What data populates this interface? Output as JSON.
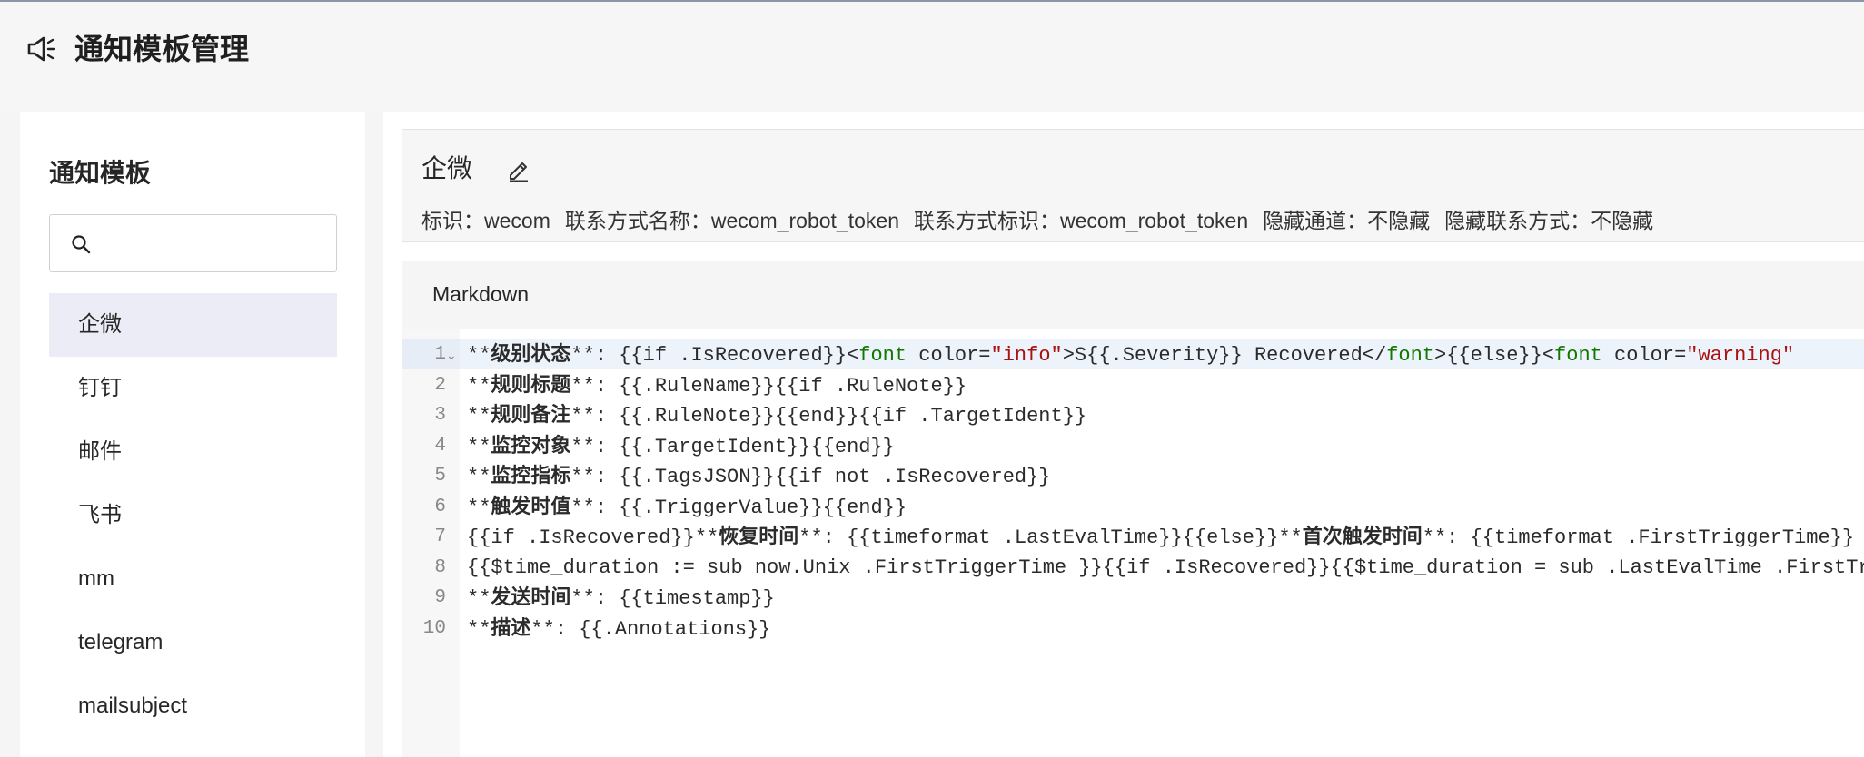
{
  "header": {
    "title": "通知模板管理",
    "icon": "megaphone-icon"
  },
  "sidebar": {
    "title": "通知模板",
    "search": {
      "placeholder": "",
      "value": ""
    },
    "items": [
      {
        "label": "企微",
        "active": true
      },
      {
        "label": "钉钉"
      },
      {
        "label": "邮件"
      },
      {
        "label": "飞书"
      },
      {
        "label": "mm"
      },
      {
        "label": "telegram"
      },
      {
        "label": "mailsubject"
      }
    ]
  },
  "detail": {
    "name": "企微",
    "ident_label": "标识：",
    "ident": "wecom",
    "contact_name_label": "联系方式名称：",
    "contact_name": "wecom_robot_token",
    "contact_ident_label": "联系方式标识：",
    "contact_ident": "wecom_robot_token",
    "hide_channel_label": "隐藏通道：",
    "hide_channel": "不隐藏",
    "hide_contact_label": "隐藏联系方式：",
    "hide_contact": "不隐藏"
  },
  "editor": {
    "tab": "Markdown",
    "line_numbers": [
      "1",
      "2",
      "3",
      "4",
      "5",
      "6",
      "7",
      "8",
      "9",
      "10"
    ],
    "lines": [
      {
        "a": "**",
        "b": "级别状态",
        "c": "**: {{if .IsRecovered}}<",
        "d": "font",
        "e": " color=",
        "f": "\"info\"",
        "g": ">S{{.Severity}} Recovered</",
        "h": "font",
        "i": ">{{else}}<",
        "j": "font",
        "k": " color=",
        "l": "\"warning\""
      },
      {
        "a": "**",
        "b": "规则标题",
        "c": "**: {{.RuleName}}{{if .RuleNote}}"
      },
      {
        "a": "**",
        "b": "规则备注",
        "c": "**: {{.RuleNote}}{{end}}{{if .TargetIdent}}"
      },
      {
        "a": "**",
        "b": "监控对象",
        "c": "**: {{.TargetIdent}}{{end}}"
      },
      {
        "a": "**",
        "b": "监控指标",
        "c": "**: {{.TagsJSON}}{{if not .IsRecovered}}"
      },
      {
        "a": "**",
        "b": "触发时值",
        "c": "**: {{.TriggerValue}}{{end}}"
      },
      {
        "a": "{{if .IsRecovered}}**",
        "b": "恢复时间",
        "c": "**: {{timeformat .LastEvalTime}}{{else}}**",
        "d2": "首次触发时间",
        "e2": "**: {{timeformat .FirstTriggerTime}}"
      },
      {
        "a": "{{$time_duration := sub now.Unix .FirstTriggerTime }}{{if .IsRecovered}}{{$time_duration = sub .LastEvalTime .FirstTriggerTime}}"
      },
      {
        "a": "**",
        "b": "发送时间",
        "c": "**: {{timestamp}}"
      },
      {
        "a": "**",
        "b": "描述",
        "c": "**: {{.Annotations}}"
      }
    ]
  }
}
